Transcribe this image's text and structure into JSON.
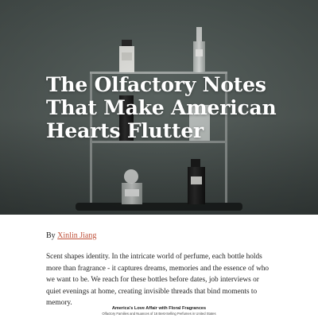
{
  "hero": {
    "title": "The Olfactory Notes That Make American Hearts Flutter"
  },
  "byline": {
    "prefix": "By",
    "author": "Xinlin Jiang"
  },
  "intro": "Scent shapes identity. In the intricate world of perfume, each bottle holds more than fragrance - it captures dreams, memories and the essence of who we want to be. We reach for these bottles before dates, job interviews or quiet evenings at home, creating invisible threads that bind moments to memory.",
  "figure": {
    "title": "America's Love Affair with Floral Fragrances",
    "subtitle": "Olfactory Families and Nuances of 16 Best-Selling Perfumes in United States"
  }
}
